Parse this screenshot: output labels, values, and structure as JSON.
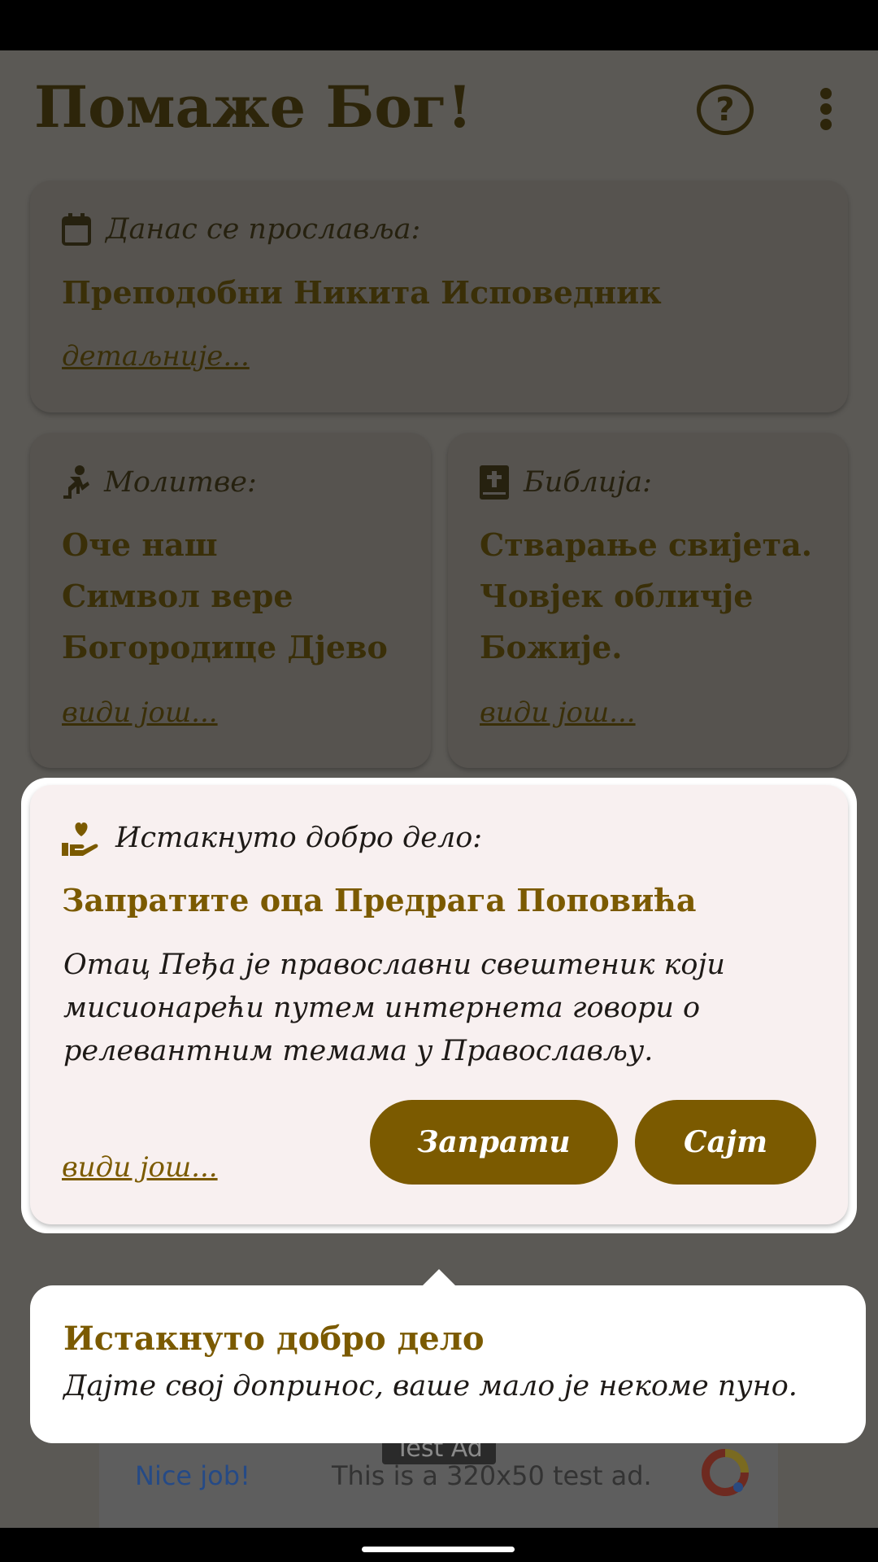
{
  "app": {
    "title": "Помаже Бог!"
  },
  "toolbar": {
    "help_icon": "help-circle-icon",
    "menu_icon": "more-vert-icon"
  },
  "feast": {
    "label": "Данас се прославља:",
    "title": "Преподобни Никита Исповедник",
    "more": "детаљније..."
  },
  "prayers": {
    "label": "Молитве:",
    "items": [
      "Оче наш",
      "Символ вере",
      "Богородице Дјево"
    ],
    "more": "види још..."
  },
  "bible": {
    "label": "Библија:",
    "lines": [
      "Стварање свијета.",
      "Човјек обличје",
      "Божије."
    ],
    "more": "види још..."
  },
  "good_deed": {
    "label": "Истакнуто добро дело:",
    "title": "Запратите оца Предрага Поповића",
    "body": "Отац Пеђа је православни свештеник који мисионарећи путем интернета говори о релевантним темама у Православљу.",
    "more": "види још...",
    "follow_button": "Запрати",
    "site_button": "Сајт"
  },
  "tooltip": {
    "title": "Истакнуто добро дело",
    "text": "Дајте свој допринос, ваше мало је некоме пуно."
  },
  "ad": {
    "badge": "Test Ad",
    "nice": "Nice job!",
    "text": "This is a 320x50 test ad."
  },
  "colors": {
    "accent": "#7b5a00",
    "scrim_background": "#5b5955",
    "card_dim": "#56534f",
    "highlight_card": "#f8f0f0"
  }
}
